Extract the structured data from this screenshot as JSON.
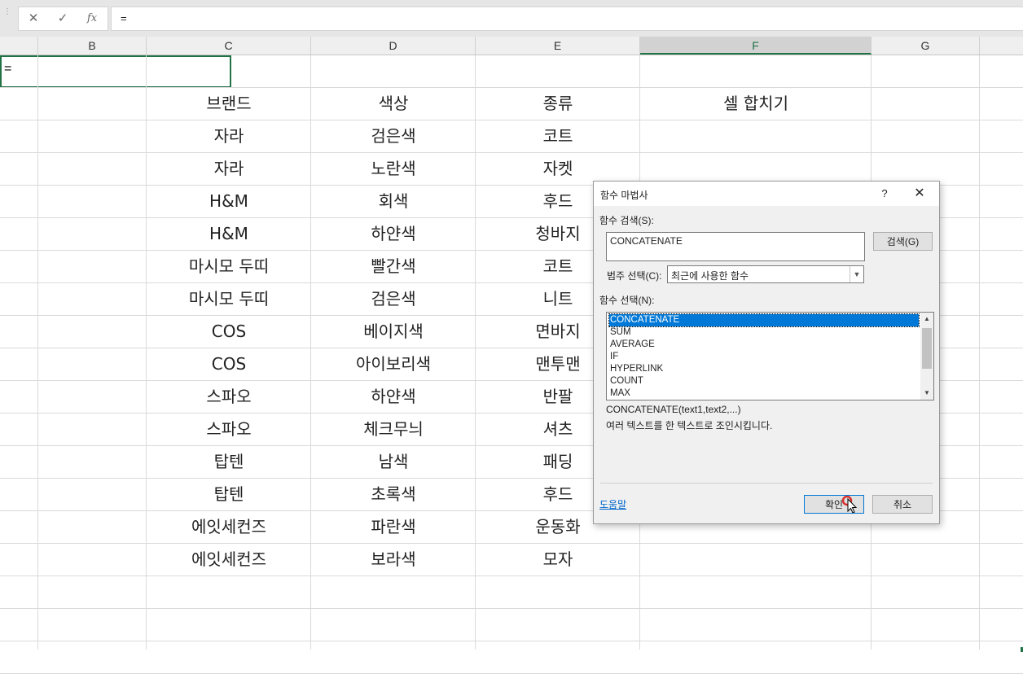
{
  "formula_bar": {
    "cancel_icon": "✕",
    "enter_icon": "✓",
    "fx_label": "fx",
    "formula": "="
  },
  "columns": [
    "B",
    "C",
    "D",
    "E",
    "F",
    "G"
  ],
  "rows": [
    [
      "",
      "",
      "",
      ""
    ],
    [
      "브랜드",
      "색상",
      "종류",
      "셀 합치기"
    ],
    [
      "자라",
      "검은색",
      "코트",
      "="
    ],
    [
      "자라",
      "노란색",
      "자켓",
      ""
    ],
    [
      "H&M",
      "회색",
      "후드",
      ""
    ],
    [
      "H&M",
      "하얀색",
      "청바지",
      ""
    ],
    [
      "마시모 두띠",
      "빨간색",
      "코트",
      ""
    ],
    [
      "마시모 두띠",
      "검은색",
      "니트",
      ""
    ],
    [
      "COS",
      "베이지색",
      "면바지",
      ""
    ],
    [
      "COS",
      "아이보리색",
      "맨투맨",
      ""
    ],
    [
      "스파오",
      "하얀색",
      "반팔",
      ""
    ],
    [
      "스파오",
      "체크무늬",
      "셔츠",
      ""
    ],
    [
      "탑텐",
      "남색",
      "패딩",
      ""
    ],
    [
      "탑텐",
      "초록색",
      "후드",
      ""
    ],
    [
      "에잇세컨즈",
      "파란색",
      "운동화",
      ""
    ],
    [
      "에잇세컨즈",
      "보라색",
      "모자",
      ""
    ]
  ],
  "dialog": {
    "title": "함수 마법사",
    "help_glyph": "?",
    "close_glyph": "✕",
    "search_label": "함수 검색(S):",
    "search_value": "CONCATENATE",
    "search_button": "검색(G)",
    "category_label": "범주 선택(C):",
    "category_value": "최근에 사용한 함수",
    "function_label": "함수 선택(N):",
    "functions": [
      "CONCATENATE",
      "SUM",
      "AVERAGE",
      "IF",
      "HYPERLINK",
      "COUNT",
      "MAX"
    ],
    "selected_function": "CONCATENATE",
    "signature": "CONCATENATE(text1,text2,...)",
    "description": "여러 텍스트를 한 텍스트로 조인시킵니다.",
    "help_link": "도움말",
    "ok_button": "확인",
    "cancel_button": "취소"
  },
  "colors": {
    "accent": "#217346",
    "selection": "#0078d7"
  }
}
